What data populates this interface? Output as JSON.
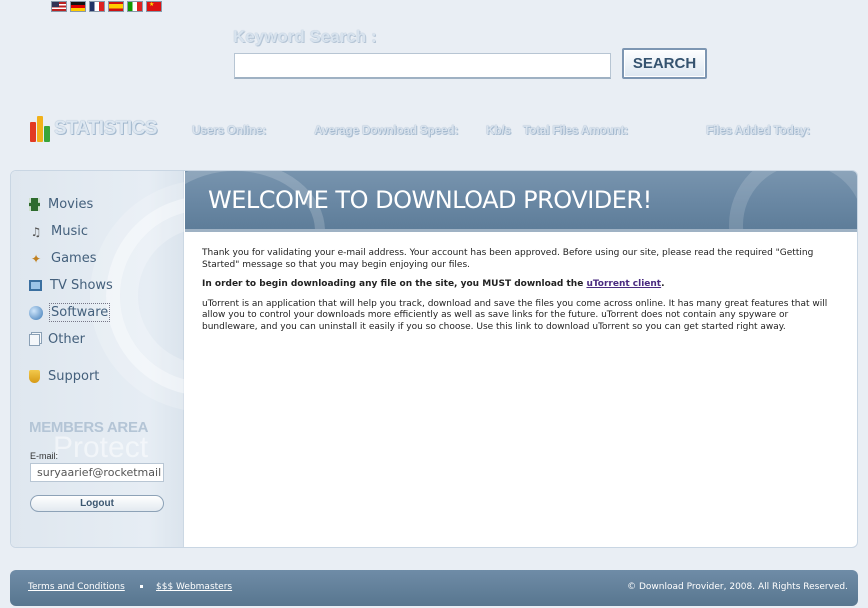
{
  "languages": [
    {
      "name": "english-flag-icon"
    },
    {
      "name": "german-flag-icon"
    },
    {
      "name": "french-flag-icon"
    },
    {
      "name": "spanish-flag-icon"
    },
    {
      "name": "italian-flag-icon"
    },
    {
      "name": "chinese-flag-icon"
    }
  ],
  "search": {
    "label": "Keyword Search :",
    "value": "",
    "button_label": "SEARCH"
  },
  "stats": {
    "logo_text": "STATISTICS",
    "users_online_label": "Users Online:",
    "avg_speed_label": "Average Download Speed:",
    "speed_unit": "Kb/s",
    "total_files_label": "Total Files Amount:",
    "files_today_label": "Files Added Today:",
    "logo_bar_colors": [
      "#e23a22",
      "#f1b11a",
      "#3aa53a"
    ]
  },
  "nav": {
    "items": [
      {
        "label": "Movies",
        "icon": "film-icon"
      },
      {
        "label": "Music",
        "icon": "music-note-icon"
      },
      {
        "label": "Games",
        "icon": "joystick-icon"
      },
      {
        "label": "TV Shows",
        "icon": "tv-icon"
      },
      {
        "label": "Software",
        "icon": "globe-icon"
      },
      {
        "label": "Other",
        "icon": "documents-icon"
      }
    ],
    "support": {
      "label": "Support",
      "icon": "shield-icon"
    }
  },
  "members": {
    "title": "MEMBERS AREA",
    "watermark": "Protect",
    "email_label": "E-mail:",
    "email_value": "suryaarief@rocketmail",
    "logout_label": "Logout"
  },
  "main": {
    "title": "WELCOME TO DOWNLOAD PROVIDER!",
    "para1": "Thank you for validating your e-mail address. Your account has been approved. Before using our site, please read the required \"Getting Started\" message so that you may begin enjoying our files.",
    "para2_prefix": "In order to begin downloading any file on the site, you MUST download the ",
    "para2_link": "uTorrent client",
    "para2_suffix": ".",
    "para3": "uTorrent is an application that will help you track, download and save the files you come across online. It has many great features that will allow you to control your downloads more efficiently as well as save links for the future. uTorrent does not contain any spyware or bundleware, and you can uninstall it easily if you so choose. Use this link to download uTorrent so you can get started right away."
  },
  "footer": {
    "terms": "Terms and Conditions",
    "webmasters": "$$$ Webmasters",
    "copyright": "© Download Provider, 2008. All Rights Reserved."
  }
}
